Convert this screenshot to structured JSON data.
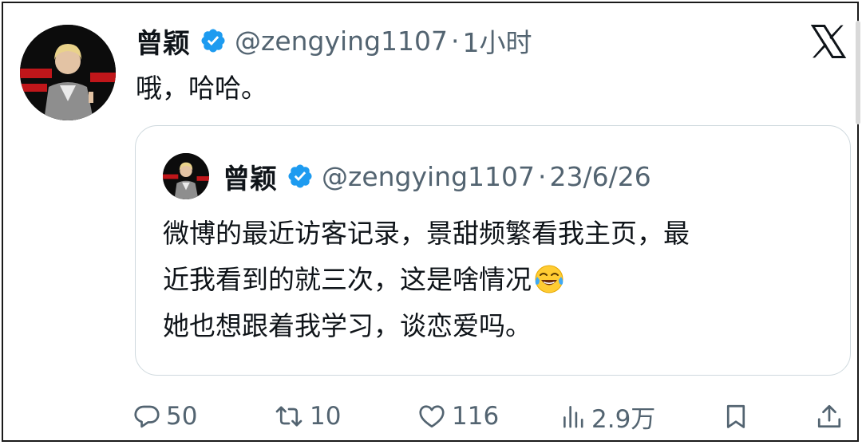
{
  "tweet": {
    "author_name": "曾颖",
    "handle": "@zengying1107",
    "separator": "·",
    "time": "1小时",
    "text": "哦，哈哈。"
  },
  "quoted_tweet": {
    "author_name": "曾颖",
    "handle": "@zengying1107",
    "separator": "·",
    "date": "23/6/26",
    "lines": [
      "微博的最近访客记录，景甜频繁看我主页，最",
      "近我看到的就三次，这是啥情况",
      "她也想跟着我学习，谈恋爱吗。"
    ],
    "emoji": "face-with-tears-of-joy"
  },
  "actions": {
    "replies": "50",
    "retweets": "10",
    "likes": "116",
    "views": "2.9万"
  },
  "icons": {
    "verified": "verified-badge-icon",
    "brand": "x-logo-icon",
    "reply": "reply-icon",
    "retweet": "retweet-icon",
    "like": "heart-icon",
    "views": "views-icon",
    "bookmark": "bookmark-icon",
    "share": "share-icon"
  },
  "colors": {
    "text_primary": "#0f1419",
    "text_secondary": "#536471",
    "verified_blue": "#1d9bf0",
    "border": "#cfd9de"
  }
}
